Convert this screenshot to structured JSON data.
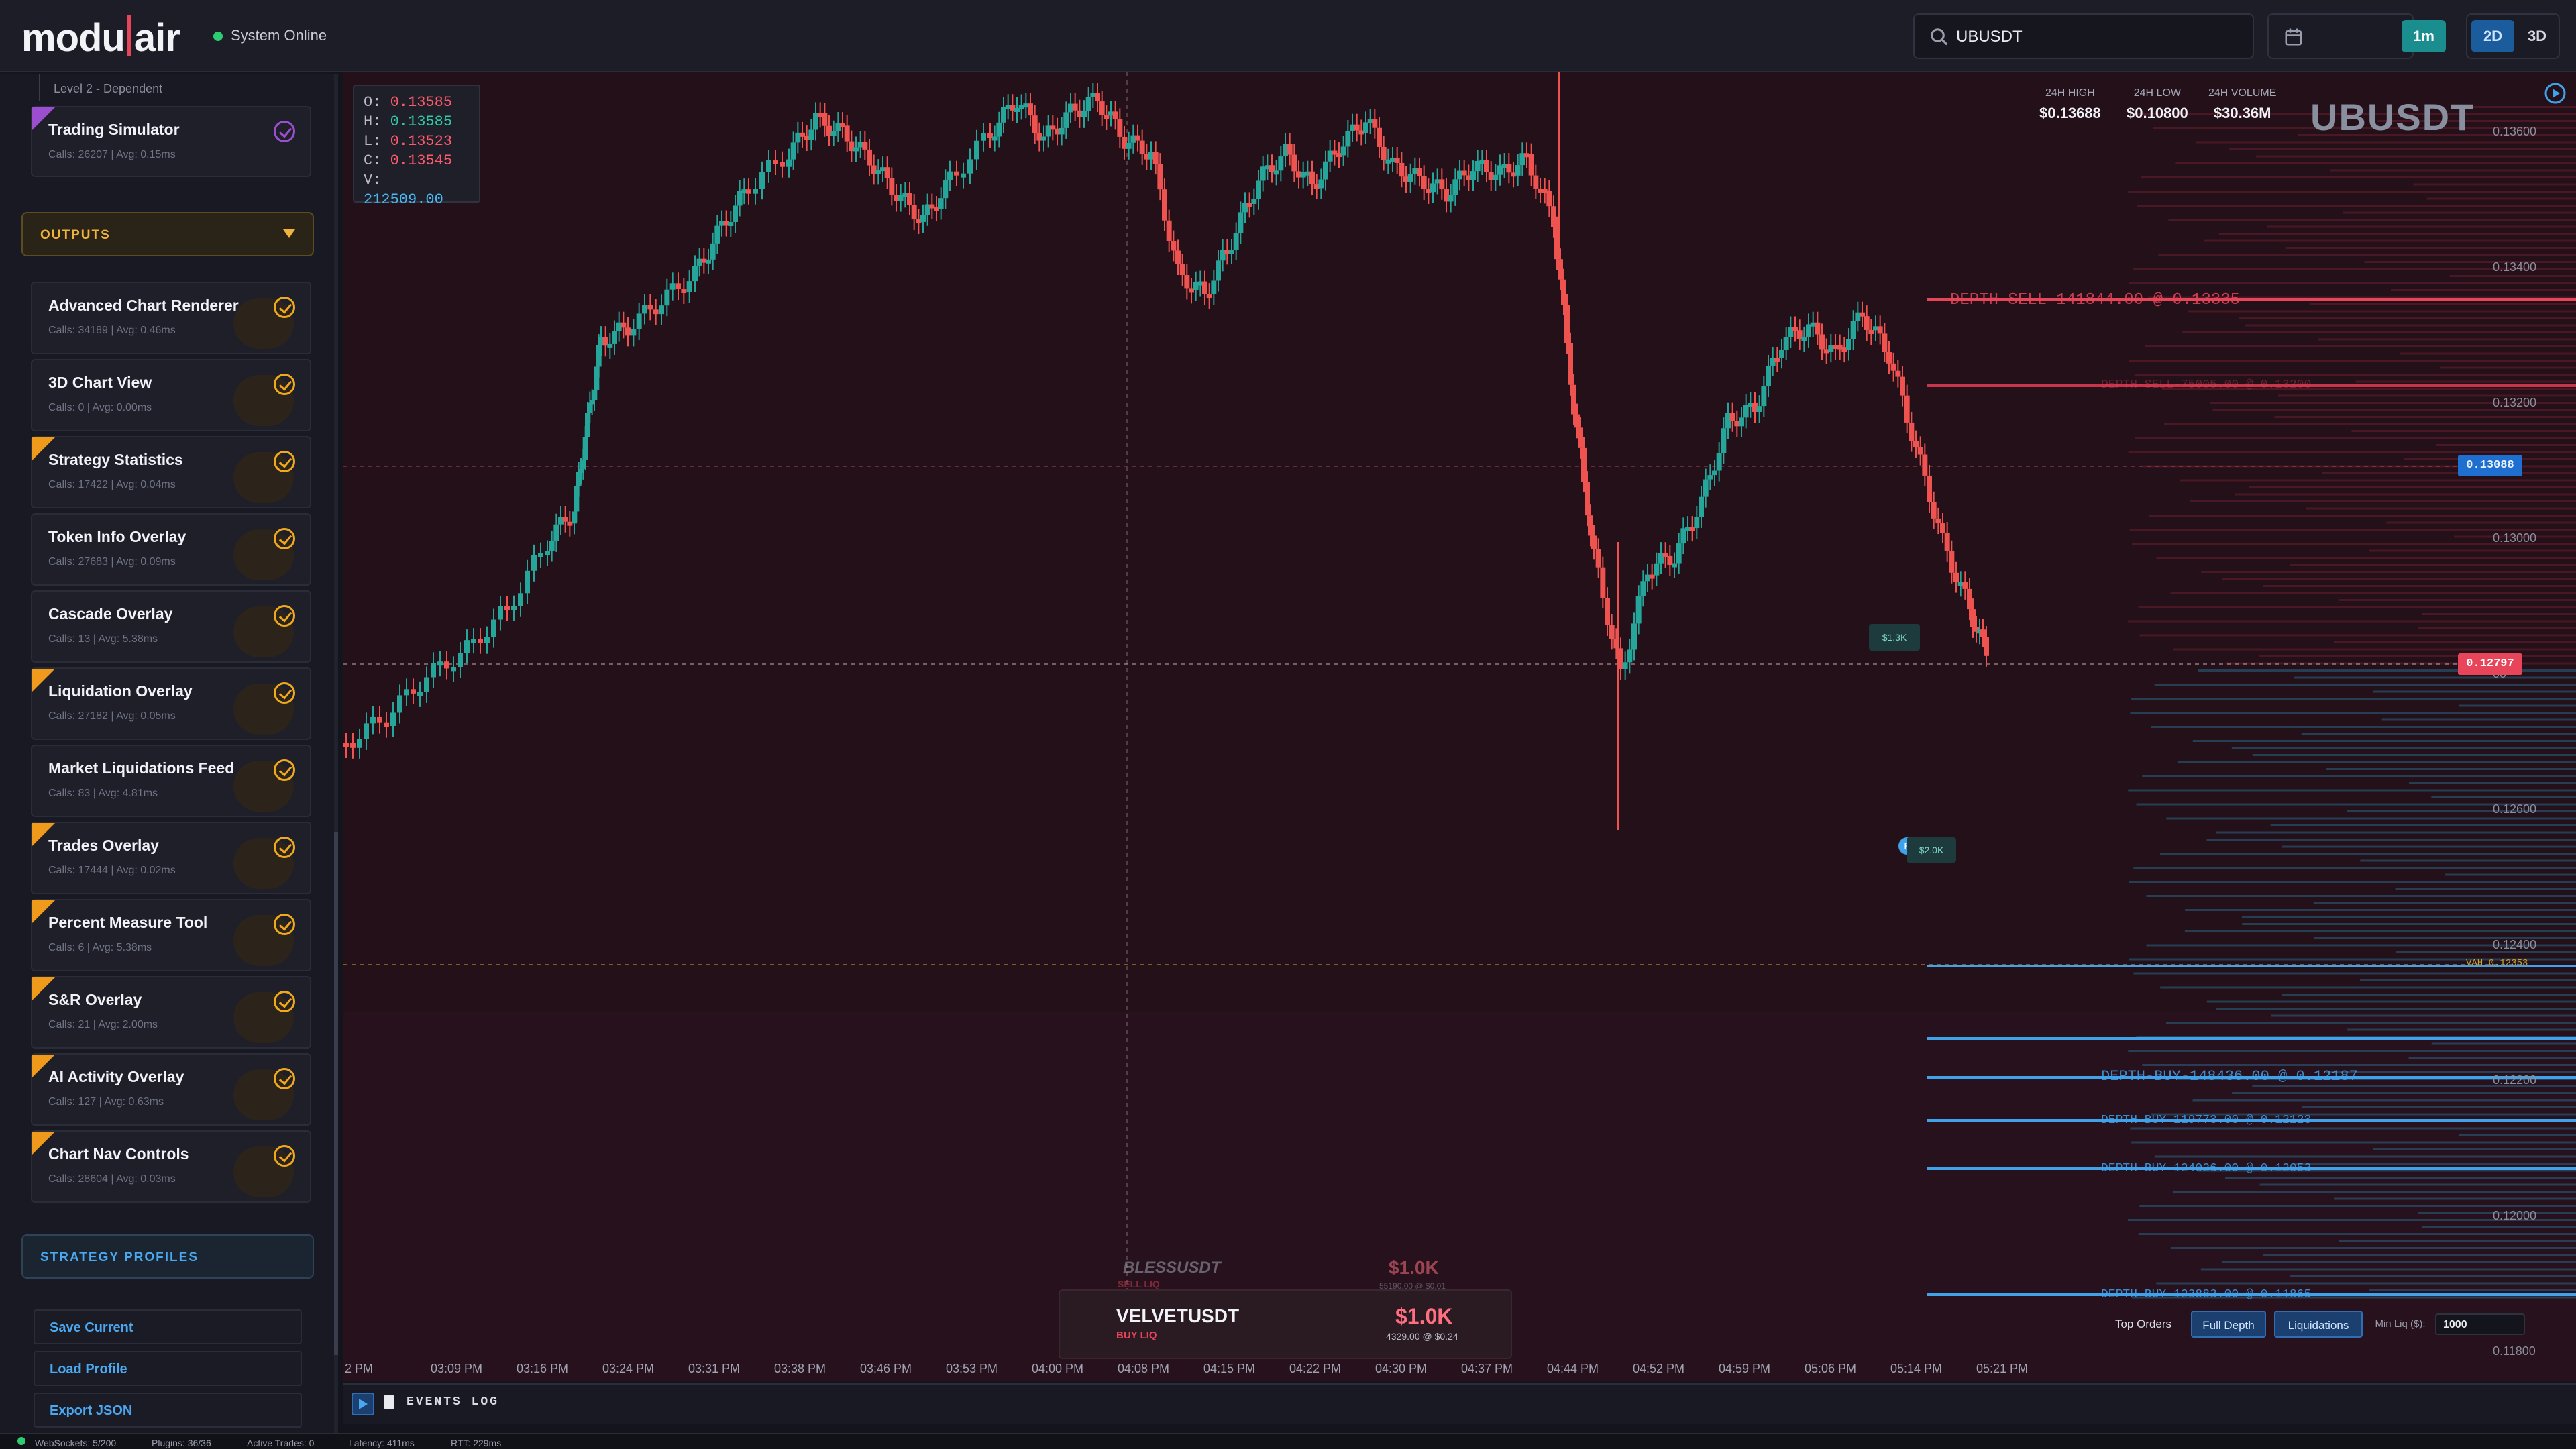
{
  "header": {
    "logo_left": "modu",
    "logo_right": "air",
    "status": "System Online",
    "search_value": "UBUSDT",
    "timeframe_label": "1m",
    "view_2d": "2D",
    "view_3d": "3D"
  },
  "sidebar": {
    "breadcrumb": "Level 2 - Dependent",
    "top_card": {
      "title": "Trading Simulator",
      "meta": "Calls: 26207 | Avg: 0.15ms"
    },
    "outputs_label": "OUTPUTS",
    "cards": [
      {
        "title": "Advanced Chart Renderer",
        "meta": "Calls: 34189 | Avg: 0.46ms",
        "flag": false
      },
      {
        "title": "3D Chart View",
        "meta": "Calls: 0 | Avg: 0.00ms",
        "flag": false
      },
      {
        "title": "Strategy Statistics",
        "meta": "Calls: 17422 | Avg: 0.04ms",
        "flag": true
      },
      {
        "title": "Token Info Overlay",
        "meta": "Calls: 27683 | Avg: 0.09ms",
        "flag": false
      },
      {
        "title": "Cascade Overlay",
        "meta": "Calls: 13 | Avg: 5.38ms",
        "flag": false
      },
      {
        "title": "Liquidation Overlay",
        "meta": "Calls: 27182 | Avg: 0.05ms",
        "flag": true
      },
      {
        "title": "Market Liquidations Feed",
        "meta": "Calls: 83 | Avg: 4.81ms",
        "flag": false
      },
      {
        "title": "Trades Overlay",
        "meta": "Calls: 17444 | Avg: 0.02ms",
        "flag": true
      },
      {
        "title": "Percent Measure Tool",
        "meta": "Calls: 6 | Avg: 5.38ms",
        "flag": true
      },
      {
        "title": "S&R Overlay",
        "meta": "Calls: 21 | Avg: 2.00ms",
        "flag": true
      },
      {
        "title": "AI Activity Overlay",
        "meta": "Calls: 127 | Avg: 0.63ms",
        "flag": true
      },
      {
        "title": "Chart Nav Controls",
        "meta": "Calls: 28604 | Avg: 0.03ms",
        "flag": true
      }
    ],
    "profiles_label": "STRATEGY PROFILES",
    "save_label": "Save Current",
    "load_label": "Load Profile",
    "export_label": "Export JSON"
  },
  "chart": {
    "ohlc": {
      "o": "0.13585",
      "h": "0.13585",
      "l": "0.13523",
      "c": "0.13545",
      "v": "212509.00"
    },
    "stats": [
      {
        "label": "24H HIGH",
        "value": "$0.13688"
      },
      {
        "label": "24H LOW",
        "value": "$0.10800"
      },
      {
        "label": "24H VOLUME",
        "value": "$30.36M"
      }
    ],
    "symbol": "UBUSDT",
    "y_labels": [
      "0.13600",
      "0.13400",
      "0.13200",
      "0.13000",
      "00",
      "0.12600",
      "0.12400",
      "0.12200",
      "0.12000",
      "0.11800"
    ],
    "x_labels": [
      "2 PM",
      "03:09 PM",
      "03:16 PM",
      "03:24 PM",
      "03:31 PM",
      "03:38 PM",
      "03:46 PM",
      "03:53 PM",
      "04:00 PM",
      "04:08 PM",
      "04:15 PM",
      "04:22 PM",
      "04:30 PM",
      "04:37 PM",
      "04:44 PM",
      "04:52 PM",
      "04:59 PM",
      "05:06 PM",
      "05:14 PM",
      "05:21 PM"
    ],
    "crosshair_price": "0.13088",
    "last_price": "0.12797",
    "vah_label": "VAH 0.12353",
    "depth_labels": [
      "DEPTH-SELL-141844.00 @ 0.13335",
      "DEPTH-SELL-75005.00 @ 0.13200",
      "DEPTH-BUY-148436.00 @ 0.12187",
      "DEPTH-BUY-119773.00 @ 0.12123",
      "DEPTH-BUY-124026.00 @ 0.12053",
      "DEPTH-BUY-123883.00 @ 0.11865"
    ],
    "bubble_1": "$1.3K",
    "bubble_2": "$2.0K",
    "toolbar": {
      "top_orders": "Top Orders",
      "full_depth": "Full Depth",
      "liquidations": "Liquidations",
      "min_liq_label": "Min Liq ($):",
      "min_liq_value": "1000"
    },
    "liq_feed": [
      {
        "symbol": "BLESSUSDT",
        "side": "SELL LIQ",
        "amount": "$1.0K",
        "detail": "55190.00 @ $0.01"
      },
      {
        "symbol": "VELVETUSDT",
        "side": "BUY LIQ",
        "amount": "$1.0K",
        "detail": "4329.00 @ $0.24"
      }
    ],
    "colors": {
      "up": "#26a69a",
      "down": "#ef5350",
      "bg": "#221018"
    }
  },
  "events_label": "EVENTS LOG",
  "footer": {
    "websockets": "WebSockets: 5/200",
    "plugins": "Plugins: 36/36",
    "active_trades": "Active Trades: 0",
    "latency": "Latency: 411ms",
    "rtt": "RTT: 229ms"
  }
}
